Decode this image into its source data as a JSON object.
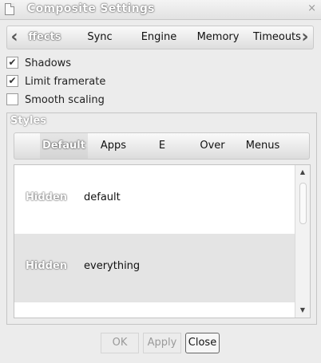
{
  "window": {
    "title": "Composite Settings",
    "close_glyph": "×"
  },
  "tabs": {
    "prev_arrow": "‹",
    "next_arrow": "›",
    "items": [
      {
        "label": "ffects",
        "active": true
      },
      {
        "label": "Sync"
      },
      {
        "label": "Engine"
      },
      {
        "label": "Memory"
      },
      {
        "label": "Timeouts"
      }
    ]
  },
  "options": [
    {
      "label": "Shadows",
      "checked": true,
      "mark": "✔"
    },
    {
      "label": "Limit framerate",
      "checked": true,
      "mark": "✔"
    },
    {
      "label": "Smooth scaling",
      "checked": false,
      "mark": ""
    }
  ],
  "styles": {
    "label": "Styles",
    "tabs": [
      {
        "label": "Default",
        "active": true
      },
      {
        "label": "Apps"
      },
      {
        "label": "E"
      },
      {
        "label": "Over"
      },
      {
        "label": "Menus"
      }
    ],
    "rows": [
      {
        "state": "Hidden",
        "name": "default"
      },
      {
        "state": "Hidden",
        "name": "everything"
      }
    ],
    "scroll_up": "▲",
    "scroll_down": "▼"
  },
  "buttons": {
    "ok": "OK",
    "apply": "Apply",
    "close": "Close"
  }
}
